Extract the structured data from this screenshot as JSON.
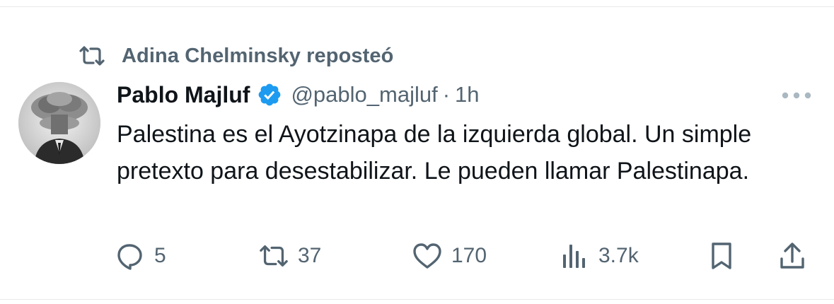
{
  "repost": {
    "label": "Adina Chelminsky reposteó",
    "icon": "repost-icon"
  },
  "tweet": {
    "author": {
      "name": "Pablo Majluf",
      "handle": "@pablo_majluf",
      "verified": true,
      "avatar": "avatar-mushroom-cloud-head"
    },
    "separator": "·",
    "time": "1h",
    "text": "Palestina es el Ayotzinapa de la izquierda global. Un simple pretexto para desestabilizar. Le pueden llamar Palestinapa.",
    "more_icon": "more-horizontal-icon"
  },
  "actions": {
    "reply": {
      "icon": "reply-icon",
      "count": "5"
    },
    "repost": {
      "icon": "repost-icon",
      "count": "37"
    },
    "like": {
      "icon": "heart-icon",
      "count": "170"
    },
    "views": {
      "icon": "views-chart-icon",
      "count": "3.7k"
    },
    "bookmark": {
      "icon": "bookmark-icon"
    },
    "share": {
      "icon": "share-icon"
    }
  },
  "colors": {
    "text_primary": "#0f1419",
    "text_secondary": "#536471",
    "verified_blue": "#1d9bf0",
    "divider": "#e6e9ec"
  }
}
